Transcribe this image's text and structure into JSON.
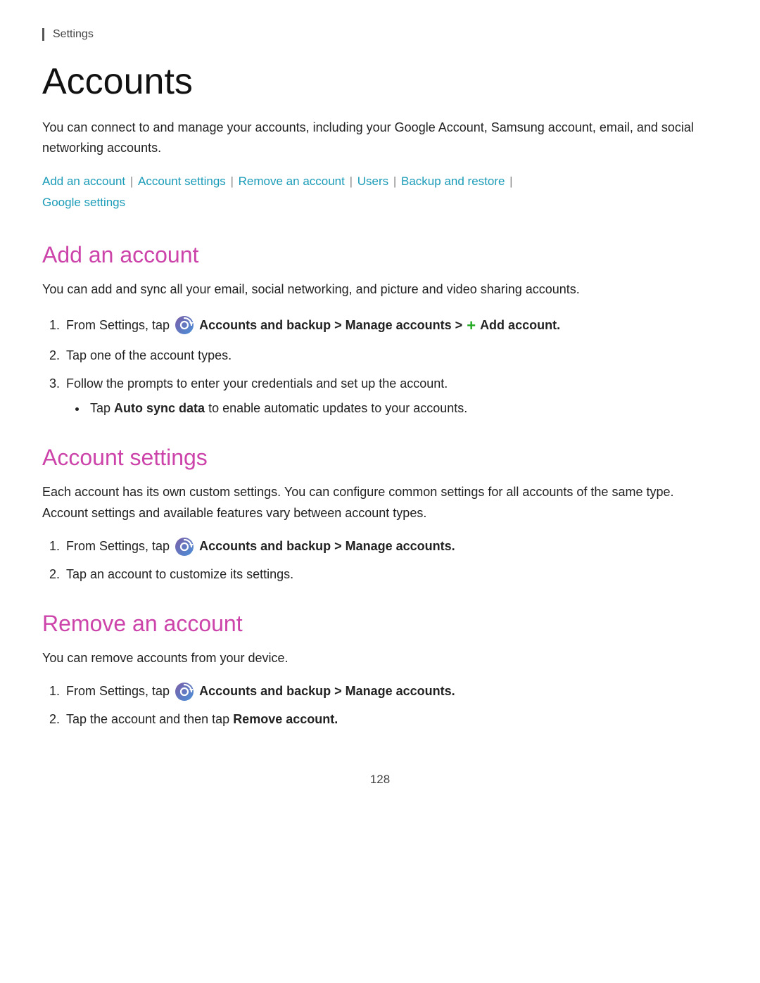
{
  "breadcrumb": {
    "label": "Settings"
  },
  "page": {
    "title": "Accounts",
    "intro": "You can connect to and manage your accounts, including your Google Account, Samsung account, email, and social networking accounts.",
    "page_number": "128"
  },
  "nav": {
    "links": [
      {
        "label": "Add an account",
        "id": "add-an-account"
      },
      {
        "label": "Account settings",
        "id": "account-settings"
      },
      {
        "label": "Remove an account",
        "id": "remove-an-account"
      },
      {
        "label": "Users",
        "id": "users"
      },
      {
        "label": "Backup and restore",
        "id": "backup-and-restore"
      },
      {
        "label": "Google settings",
        "id": "google-settings"
      }
    ]
  },
  "sections": {
    "add_account": {
      "title": "Add an account",
      "intro": "You can add and sync all your email, social networking, and picture and video sharing accounts.",
      "steps": [
        {
          "text_before": "From Settings, tap",
          "bold_text": "Accounts and backup > Manage accounts >",
          "icon": true,
          "plus": true,
          "bold_text_2": "Add account."
        },
        {
          "text": "Tap one of the account types."
        },
        {
          "text": "Follow the prompts to enter your credentials and set up the account.",
          "bullet": "Tap Auto sync data to enable automatic updates to your accounts."
        }
      ]
    },
    "account_settings": {
      "title": "Account settings",
      "intro": "Each account has its own custom settings. You can configure common settings for all accounts of the same type. Account settings and available features vary between account types.",
      "steps": [
        {
          "text_before": "From Settings, tap",
          "bold_text": "Accounts and backup > Manage accounts.",
          "icon": true
        },
        {
          "text": "Tap an account to customize its settings."
        }
      ]
    },
    "remove_account": {
      "title": "Remove an account",
      "intro": "You can remove accounts from your device.",
      "steps": [
        {
          "text_before": "From Settings, tap",
          "bold_text": "Accounts and backup > Manage accounts.",
          "icon": true
        },
        {
          "text_before_plain": "Tap the account and then tap",
          "bold_text": "Remove account."
        }
      ]
    }
  }
}
